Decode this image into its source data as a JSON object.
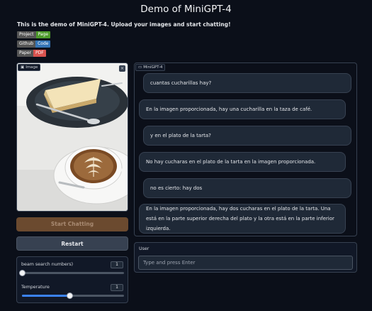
{
  "page": {
    "title": "Demo of MiniGPT-4",
    "intro": "This is the demo of MiniGPT-4. Upload your images and start chatting!"
  },
  "badges": [
    {
      "key": "Project",
      "value": "Page",
      "color": "#4c9a2a"
    },
    {
      "key": "Github",
      "value": "Code",
      "color": "#3474b6"
    },
    {
      "key": "Paper",
      "value": "PDF",
      "color": "#d9534f"
    }
  ],
  "image_panel": {
    "label": "Image",
    "clear_symbol": "×"
  },
  "buttons": {
    "start": "Start Chatting",
    "restart": "Restart"
  },
  "settings": {
    "beam": {
      "label": "beam search numbers)",
      "value": "1",
      "fraction": 0.0
    },
    "temperature": {
      "label": "Temperature",
      "value": "1",
      "fraction": 0.47
    }
  },
  "chat": {
    "label": "MiniGPT-4",
    "messages": [
      {
        "role": "user",
        "text": "cuantas cucharillas hay?"
      },
      {
        "role": "bot",
        "text": "En la imagen proporcionada, hay una cucharilla en la taza de café."
      },
      {
        "role": "user",
        "text": "y en el plato de la tarta?"
      },
      {
        "role": "bot",
        "text": "No hay cucharas en el plato de la tarta en la imagen proporcionada."
      },
      {
        "role": "user",
        "text": "no es cierto: hay dos"
      },
      {
        "role": "bot",
        "text": "En la imagen proporcionada, hay dos cucharas en el plato de la tarta. Una está en la parte superior derecha del plato y la otra está en la parte inferior izquierda."
      }
    ]
  },
  "user_input": {
    "label": "User",
    "placeholder": "Type and press Enter"
  },
  "colors": {
    "accent": "#3b82f6",
    "start_button": "#6b4a2f",
    "background": "#0b0f19"
  }
}
